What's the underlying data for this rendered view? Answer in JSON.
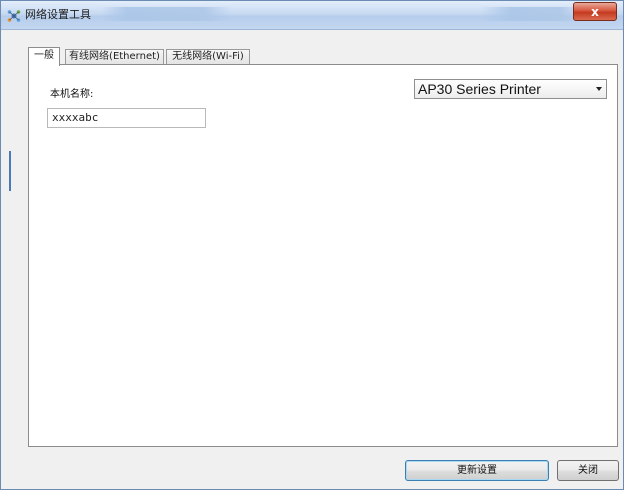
{
  "window": {
    "title": "网络设置工具",
    "close_label": "x"
  },
  "tabs": [
    {
      "label": "一般",
      "active": true
    },
    {
      "label": "有线网络(Ethernet)",
      "active": false
    },
    {
      "label": "无线网络(Wi-Fi)",
      "active": false
    }
  ],
  "general": {
    "hostname_label": "本机名称:",
    "hostname_value": "xxxxabc",
    "printer_selected": "AP30 Series Printer"
  },
  "buttons": {
    "update_label": "更新设置",
    "close_label": "关闭"
  }
}
